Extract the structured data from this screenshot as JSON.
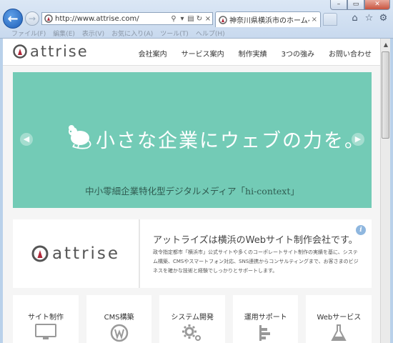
{
  "browser": {
    "address": "http://www.attrise.com/",
    "tab_title": "神奈川県横浜市のホームペ...",
    "menu": [
      "ファイル(F)",
      "編集(E)",
      "表示(V)",
      "お気に入り(A)",
      "ツール(T)",
      "ヘルプ(H)"
    ],
    "window_controls": {
      "minimize": "–",
      "maximize": "▭",
      "close": "✕"
    },
    "icons": {
      "back": "back-arrow-icon",
      "forward": "forward-arrow-icon",
      "home": "home-icon",
      "favorites": "star-icon",
      "tools": "gear-icon"
    }
  },
  "site": {
    "logo_text": "attrise",
    "nav": [
      "会社案内",
      "サービス案内",
      "制作実績",
      "3つの強み",
      "お問い合わせ"
    ],
    "hero": {
      "title": "小さな企業にウェブの力を。",
      "subtitle": "中小零細企業特化型デジタルメディア「hi-context」",
      "bg_color": "#73cbb6"
    },
    "intro": {
      "logo_text": "attrise",
      "heading": "アットライズは横浜のWebサイト制作会社です。",
      "body": "政令指定都市「横浜市」公式サイトや多くのコーポレートサイト制作の実績を基に、システム構築、CMSやスマートフォン対応、SNS連携からコンサルティングまで、お客さまのビジネスを確かな技術と経験でしっかりとサポートします。"
    },
    "services": [
      {
        "label": "サイト制作",
        "icon": "monitor-icon"
      },
      {
        "label": "CMS構築",
        "icon": "wordpress-icon"
      },
      {
        "label": "システム開発",
        "icon": "gear-icon"
      },
      {
        "label": "運用サポート",
        "icon": "bar-chart-icon"
      },
      {
        "label": "Webサービス",
        "icon": "flask-icon"
      }
    ]
  }
}
